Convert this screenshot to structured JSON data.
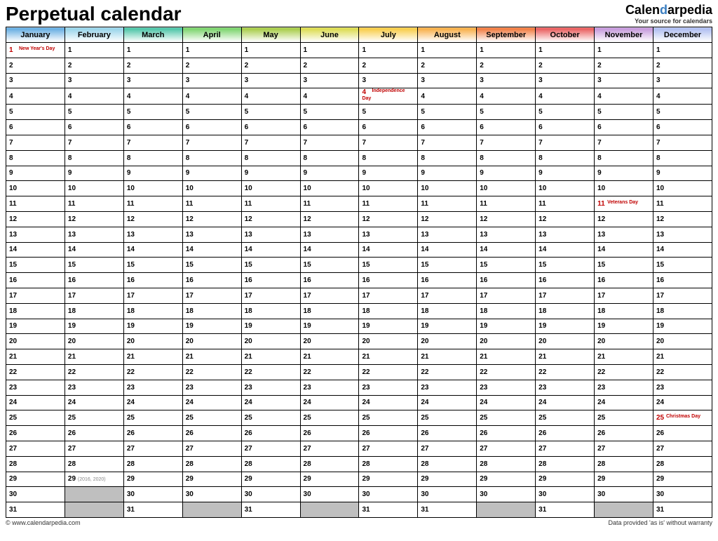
{
  "title": "Perpetual calendar",
  "brand": {
    "part1": "Calen",
    "part2": "d",
    "part3": "arpedia",
    "tag": "Your source for calendars"
  },
  "months": [
    {
      "name": "January",
      "days": 31,
      "color": "#5aa7e0"
    },
    {
      "name": "February",
      "days": 29,
      "color": "#8fd0e8"
    },
    {
      "name": "March",
      "days": 31,
      "color": "#3fc0a0"
    },
    {
      "name": "April",
      "days": 30,
      "color": "#70d060"
    },
    {
      "name": "May",
      "days": 31,
      "color": "#a0c838"
    },
    {
      "name": "June",
      "days": 30,
      "color": "#d8d840"
    },
    {
      "name": "July",
      "days": 31,
      "color": "#f8c838"
    },
    {
      "name": "August",
      "days": 31,
      "color": "#f8a838"
    },
    {
      "name": "September",
      "days": 30,
      "color": "#f07030"
    },
    {
      "name": "October",
      "days": 31,
      "color": "#e85050"
    },
    {
      "name": "November",
      "days": 30,
      "color": "#c090d8"
    },
    {
      "name": "December",
      "days": 31,
      "color": "#a8b8f0"
    }
  ],
  "holidays": {
    "0-1": "New Year's Day",
    "6-4": "Independence Day",
    "10-11": "Veterans Day",
    "11-25": "Christmas Day"
  },
  "notes": {
    "1-29": "(2016, 2020)"
  },
  "footer": {
    "left": "© www.calendarpedia.com",
    "right": "Data provided 'as is' without warranty"
  }
}
